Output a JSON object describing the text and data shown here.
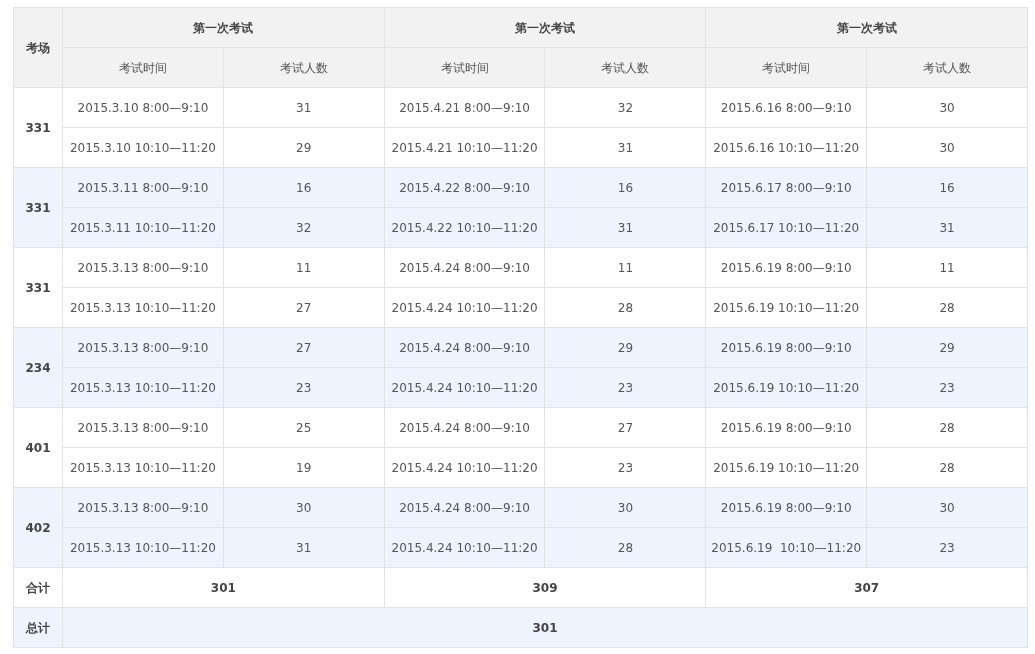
{
  "table": {
    "corner": "考场",
    "groups": [
      {
        "title": "第一次考试",
        "columns": [
          "考试时间",
          "考试人数"
        ]
      },
      {
        "title": "第一次考试",
        "columns": [
          "考试时间",
          "考试人数"
        ]
      },
      {
        "title": "第一次考试",
        "columns": [
          "考试时间",
          "考试人数"
        ]
      }
    ],
    "rooms": [
      {
        "room": "331",
        "rows": [
          [
            "2015.3.10 8:00—9:10",
            "31",
            "2015.4.21 8:00—9:10",
            "32",
            "2015.6.16 8:00—9:10",
            "30"
          ],
          [
            "2015.3.10 10:10—11:20",
            "29",
            "2015.4.21 10:10—11:20",
            "31",
            "2015.6.16 10:10—11:20",
            "30"
          ]
        ]
      },
      {
        "room": "331",
        "rows": [
          [
            "2015.3.11 8:00—9:10",
            "16",
            "2015.4.22 8:00—9:10",
            "16",
            "2015.6.17 8:00—9:10",
            "16"
          ],
          [
            "2015.3.11 10:10—11:20",
            "32",
            "2015.4.22 10:10—11:20",
            "31",
            "2015.6.17 10:10—11:20",
            "31"
          ]
        ]
      },
      {
        "room": "331",
        "rows": [
          [
            "2015.3.13 8:00—9:10",
            "11",
            "2015.4.24 8:00—9:10",
            "11",
            "2015.6.19 8:00—9:10",
            "11"
          ],
          [
            "2015.3.13 10:10—11:20",
            "27",
            "2015.4.24 10:10—11:20",
            "28",
            "2015.6.19 10:10—11:20",
            "28"
          ]
        ]
      },
      {
        "room": "234",
        "rows": [
          [
            "2015.3.13 8:00—9:10",
            "27",
            "2015.4.24 8:00—9:10",
            "29",
            "2015.6.19 8:00—9:10",
            "29"
          ],
          [
            "2015.3.13 10:10—11:20",
            "23",
            "2015.4.24 10:10—11:20",
            "23",
            "2015.6.19 10:10—11:20",
            "23"
          ]
        ]
      },
      {
        "room": "401",
        "rows": [
          [
            "2015.3.13 8:00—9:10",
            "25",
            "2015.4.24 8:00—9:10",
            "27",
            "2015.6.19 8:00—9:10",
            "28"
          ],
          [
            "2015.3.13 10:10—11:20",
            "19",
            "2015.4.24 10:10—11:20",
            "23",
            "2015.6.19 10:10—11:20",
            "28"
          ]
        ]
      },
      {
        "room": "402",
        "rows": [
          [
            "2015.3.13 8:00—9:10",
            "30",
            "2015.4.24 8:00—9:10",
            "30",
            "2015.6.19 8:00—9:10",
            "30"
          ],
          [
            "2015.3.13 10:10—11:20",
            "31",
            "2015.4.24 10:10—11:20",
            "28",
            "2015.6.19  10:10—11:20",
            "23"
          ]
        ]
      }
    ],
    "subtotal": {
      "label": "合计",
      "values": [
        "301",
        "309",
        "307"
      ]
    },
    "total": {
      "label": "总计",
      "value": "301"
    }
  }
}
